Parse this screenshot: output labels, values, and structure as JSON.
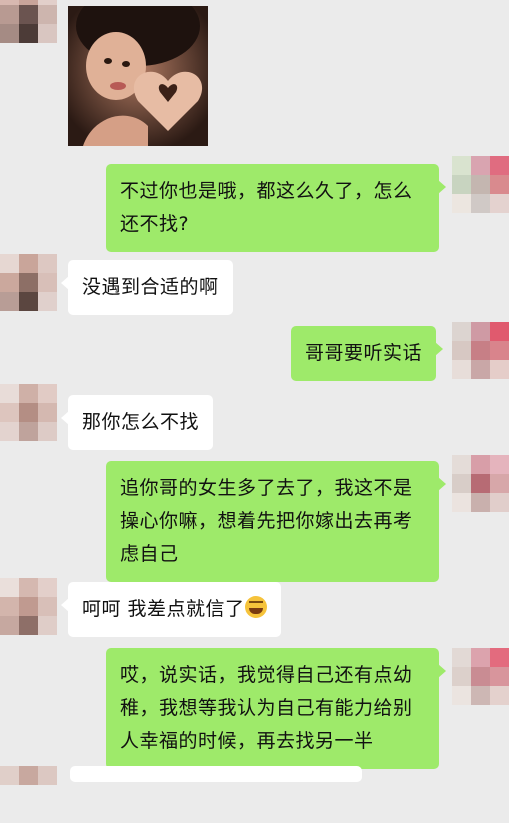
{
  "conversation": {
    "photo_message": {
      "icon": "heart-hands-photo"
    },
    "messages": [
      {
        "side": "out",
        "text": "不过你也是哦，都这么久了，怎么还不找?"
      },
      {
        "side": "in",
        "text": "没遇到合适的啊"
      },
      {
        "side": "out",
        "text": "哥哥要听实话"
      },
      {
        "side": "in",
        "text": "那你怎么不找"
      },
      {
        "side": "out",
        "text": "追你哥的女生多了去了，我这不是操心你嘛，想着先把你嫁出去再考虑自己"
      },
      {
        "side": "in",
        "text": "呵呵 我差点就信了",
        "emoji": "laughing-crying-emoji"
      },
      {
        "side": "out",
        "text": "哎，说实话，我觉得自己还有点幼稚，我想等我认为自己有能力给别人幸福的时候，再去找另一半"
      }
    ]
  },
  "colors": {
    "background": "#ebebeb",
    "outgoing_bubble": "#9eea6a",
    "incoming_bubble": "#ffffff"
  }
}
